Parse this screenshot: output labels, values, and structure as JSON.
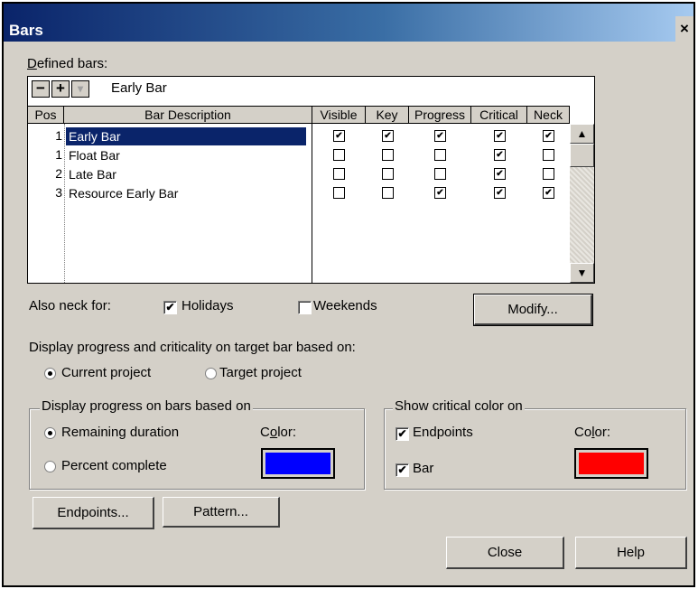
{
  "window": {
    "title": "Bars",
    "close_glyph": "×"
  },
  "defined_bars": {
    "label_prefix": "",
    "label_mnemonic": "D",
    "label_rest": "efined bars:",
    "minus_label": "−",
    "plus_label": "+",
    "dropdown_glyph": "▾",
    "edit_value": "Early Bar",
    "columns": [
      "Pos",
      "Bar Description",
      "Visible",
      "Key",
      "Progress",
      "Critical",
      "Neck"
    ],
    "rows": [
      {
        "pos": "1",
        "desc": "Early Bar",
        "visible": true,
        "key": true,
        "progress": true,
        "critical": true,
        "neck": true,
        "selected": true
      },
      {
        "pos": "1",
        "desc": "Float Bar",
        "visible": false,
        "key": false,
        "progress": false,
        "critical": true,
        "neck": false,
        "selected": false
      },
      {
        "pos": "2",
        "desc": "Late Bar",
        "visible": false,
        "key": false,
        "progress": false,
        "critical": true,
        "neck": false,
        "selected": false
      },
      {
        "pos": "3",
        "desc": "Resource Early Bar",
        "visible": false,
        "key": false,
        "progress": true,
        "critical": true,
        "neck": true,
        "selected": false
      }
    ],
    "scroll_up_glyph": "▲",
    "scroll_down_glyph": "▼"
  },
  "neck": {
    "label": "Also neck for:",
    "holidays_label": "Holidays",
    "holidays_checked": true,
    "weekends_label": "Weekends",
    "weekends_checked": false
  },
  "modify_label": "Modify...",
  "target": {
    "label": "Display progress and criticality on target bar based on:",
    "current_label": "Current project",
    "target_label": "Target project",
    "selected": "current"
  },
  "progress_group": {
    "title": "Display progress on bars based on",
    "remaining_label": "Remaining duration",
    "percent_label": "Percent complete",
    "selected": "remaining",
    "color_label_a": "C",
    "color_label_mn": "o",
    "color_label_b": "lor:",
    "color": "#0000ff"
  },
  "critical_group": {
    "title": "Show critical color on",
    "endpoints_label": "Endpoints",
    "endpoints_checked": true,
    "bar_label": "Bar",
    "bar_checked": true,
    "color_label_a": "Co",
    "color_label_mn": "l",
    "color_label_b": "or:",
    "color": "#ff0000"
  },
  "buttons": {
    "endpoints": "Endpoints...",
    "pattern": "Pattern...",
    "close": "Close",
    "help": "Help"
  },
  "check_glyph": "✔"
}
